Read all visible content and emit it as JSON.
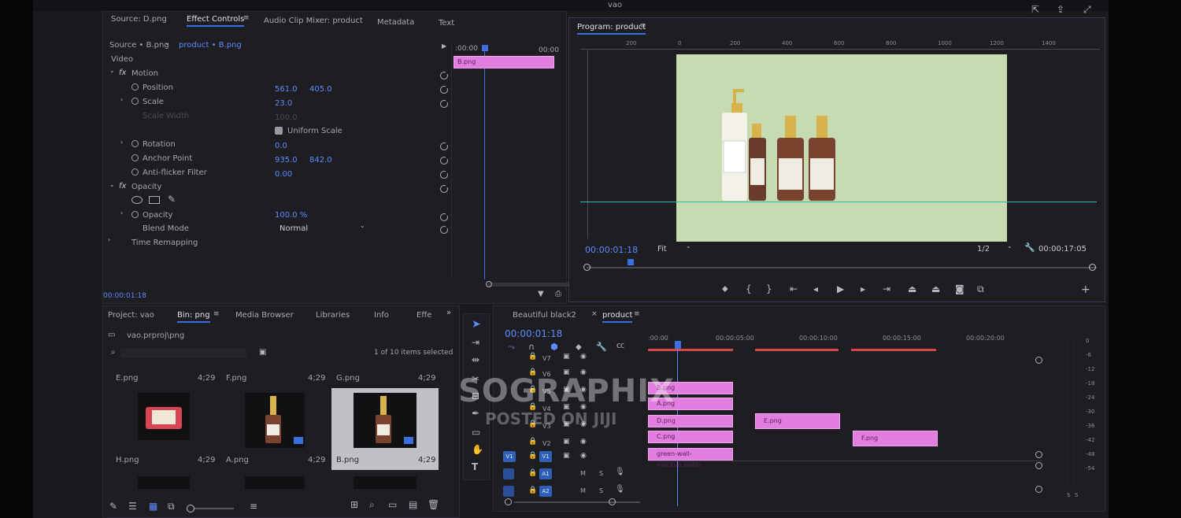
{
  "window": {
    "title": "vao"
  },
  "effect_controls": {
    "tabs": [
      "Source: D.png",
      "Effect Controls",
      "Audio Clip Mixer: product",
      "Metadata",
      "Text"
    ],
    "source_left": "Source • B.png",
    "source_right": "product • B.png",
    "section_video": "Video",
    "motion": "Motion",
    "position_label": "Position",
    "position_x": "561.0",
    "position_y": "405.0",
    "scale_label": "Scale",
    "scale_value": "23.0",
    "scale_width_label": "Scale Width",
    "scale_width_value": "100.0",
    "uniform_scale": "Uniform Scale",
    "rotation_label": "Rotation",
    "rotation_value": "0.0",
    "anchor_label": "Anchor Point",
    "anchor_x": "935.0",
    "anchor_y": "842.0",
    "antiflicker_label": "Anti-flicker Filter",
    "antiflicker_value": "0.00",
    "opacity_section": "Opacity",
    "opacity_label": "Opacity",
    "opacity_value": "100.0 %",
    "blend_label": "Blend Mode",
    "blend_value": "Normal",
    "time_remap": "Time Remapping",
    "mini_tc_start": ":00:00",
    "mini_tc_end": "00:00",
    "mini_clip": "B.png",
    "bottom_tc": "00:00:01:18"
  },
  "program": {
    "title": "Program: product",
    "timecode": "00:00:01:18",
    "fit": "Fit",
    "resolution": "1/2",
    "duration": "00:00:17:05",
    "ruler": [
      "200",
      "0",
      "200",
      "400",
      "600",
      "800",
      "1000",
      "1200",
      "1400"
    ]
  },
  "project": {
    "tabs": [
      "Project: vao",
      "Bin: png",
      "Media Browser",
      "Libraries",
      "Info",
      "Effe"
    ],
    "path": "vao.prproj\\png",
    "selection": "1 of 10 items selected",
    "items": [
      {
        "name": "E.png",
        "dur": "4;29"
      },
      {
        "name": "F.png",
        "dur": "4;29"
      },
      {
        "name": "G.png",
        "dur": "4;29"
      },
      {
        "name": "H.png",
        "dur": "4;29"
      },
      {
        "name": "A.png",
        "dur": "4;29"
      },
      {
        "name": "B.png",
        "dur": "4;29"
      }
    ]
  },
  "timeline": {
    "tabs": [
      "Beautiful black2",
      "product"
    ],
    "timecode": "00:00:01:18",
    "ruler": [
      ":00:00",
      "00:00:05:00",
      "00:00:10:00",
      "00:00:15:00",
      "00:00:20:00"
    ],
    "tracks_video": [
      "V7",
      "V6",
      "V5",
      "V4",
      "V3",
      "V2",
      "V1"
    ],
    "tracks_audio": [
      "A1",
      "A2"
    ],
    "clips": [
      "B.png",
      "A.png",
      "D.png",
      "C.png",
      "green-wall-mockup.webp",
      "E.png",
      "F.png"
    ],
    "meter_labels": [
      "0",
      "-6",
      "-12",
      "-18",
      "-24",
      "-30",
      "-36",
      "-42",
      "-48",
      "-54"
    ],
    "meter_bottom": [
      "S",
      "S"
    ]
  },
  "watermark": {
    "line1": "SOGRAPHIX",
    "line2": "POSTED ON JIJI"
  }
}
